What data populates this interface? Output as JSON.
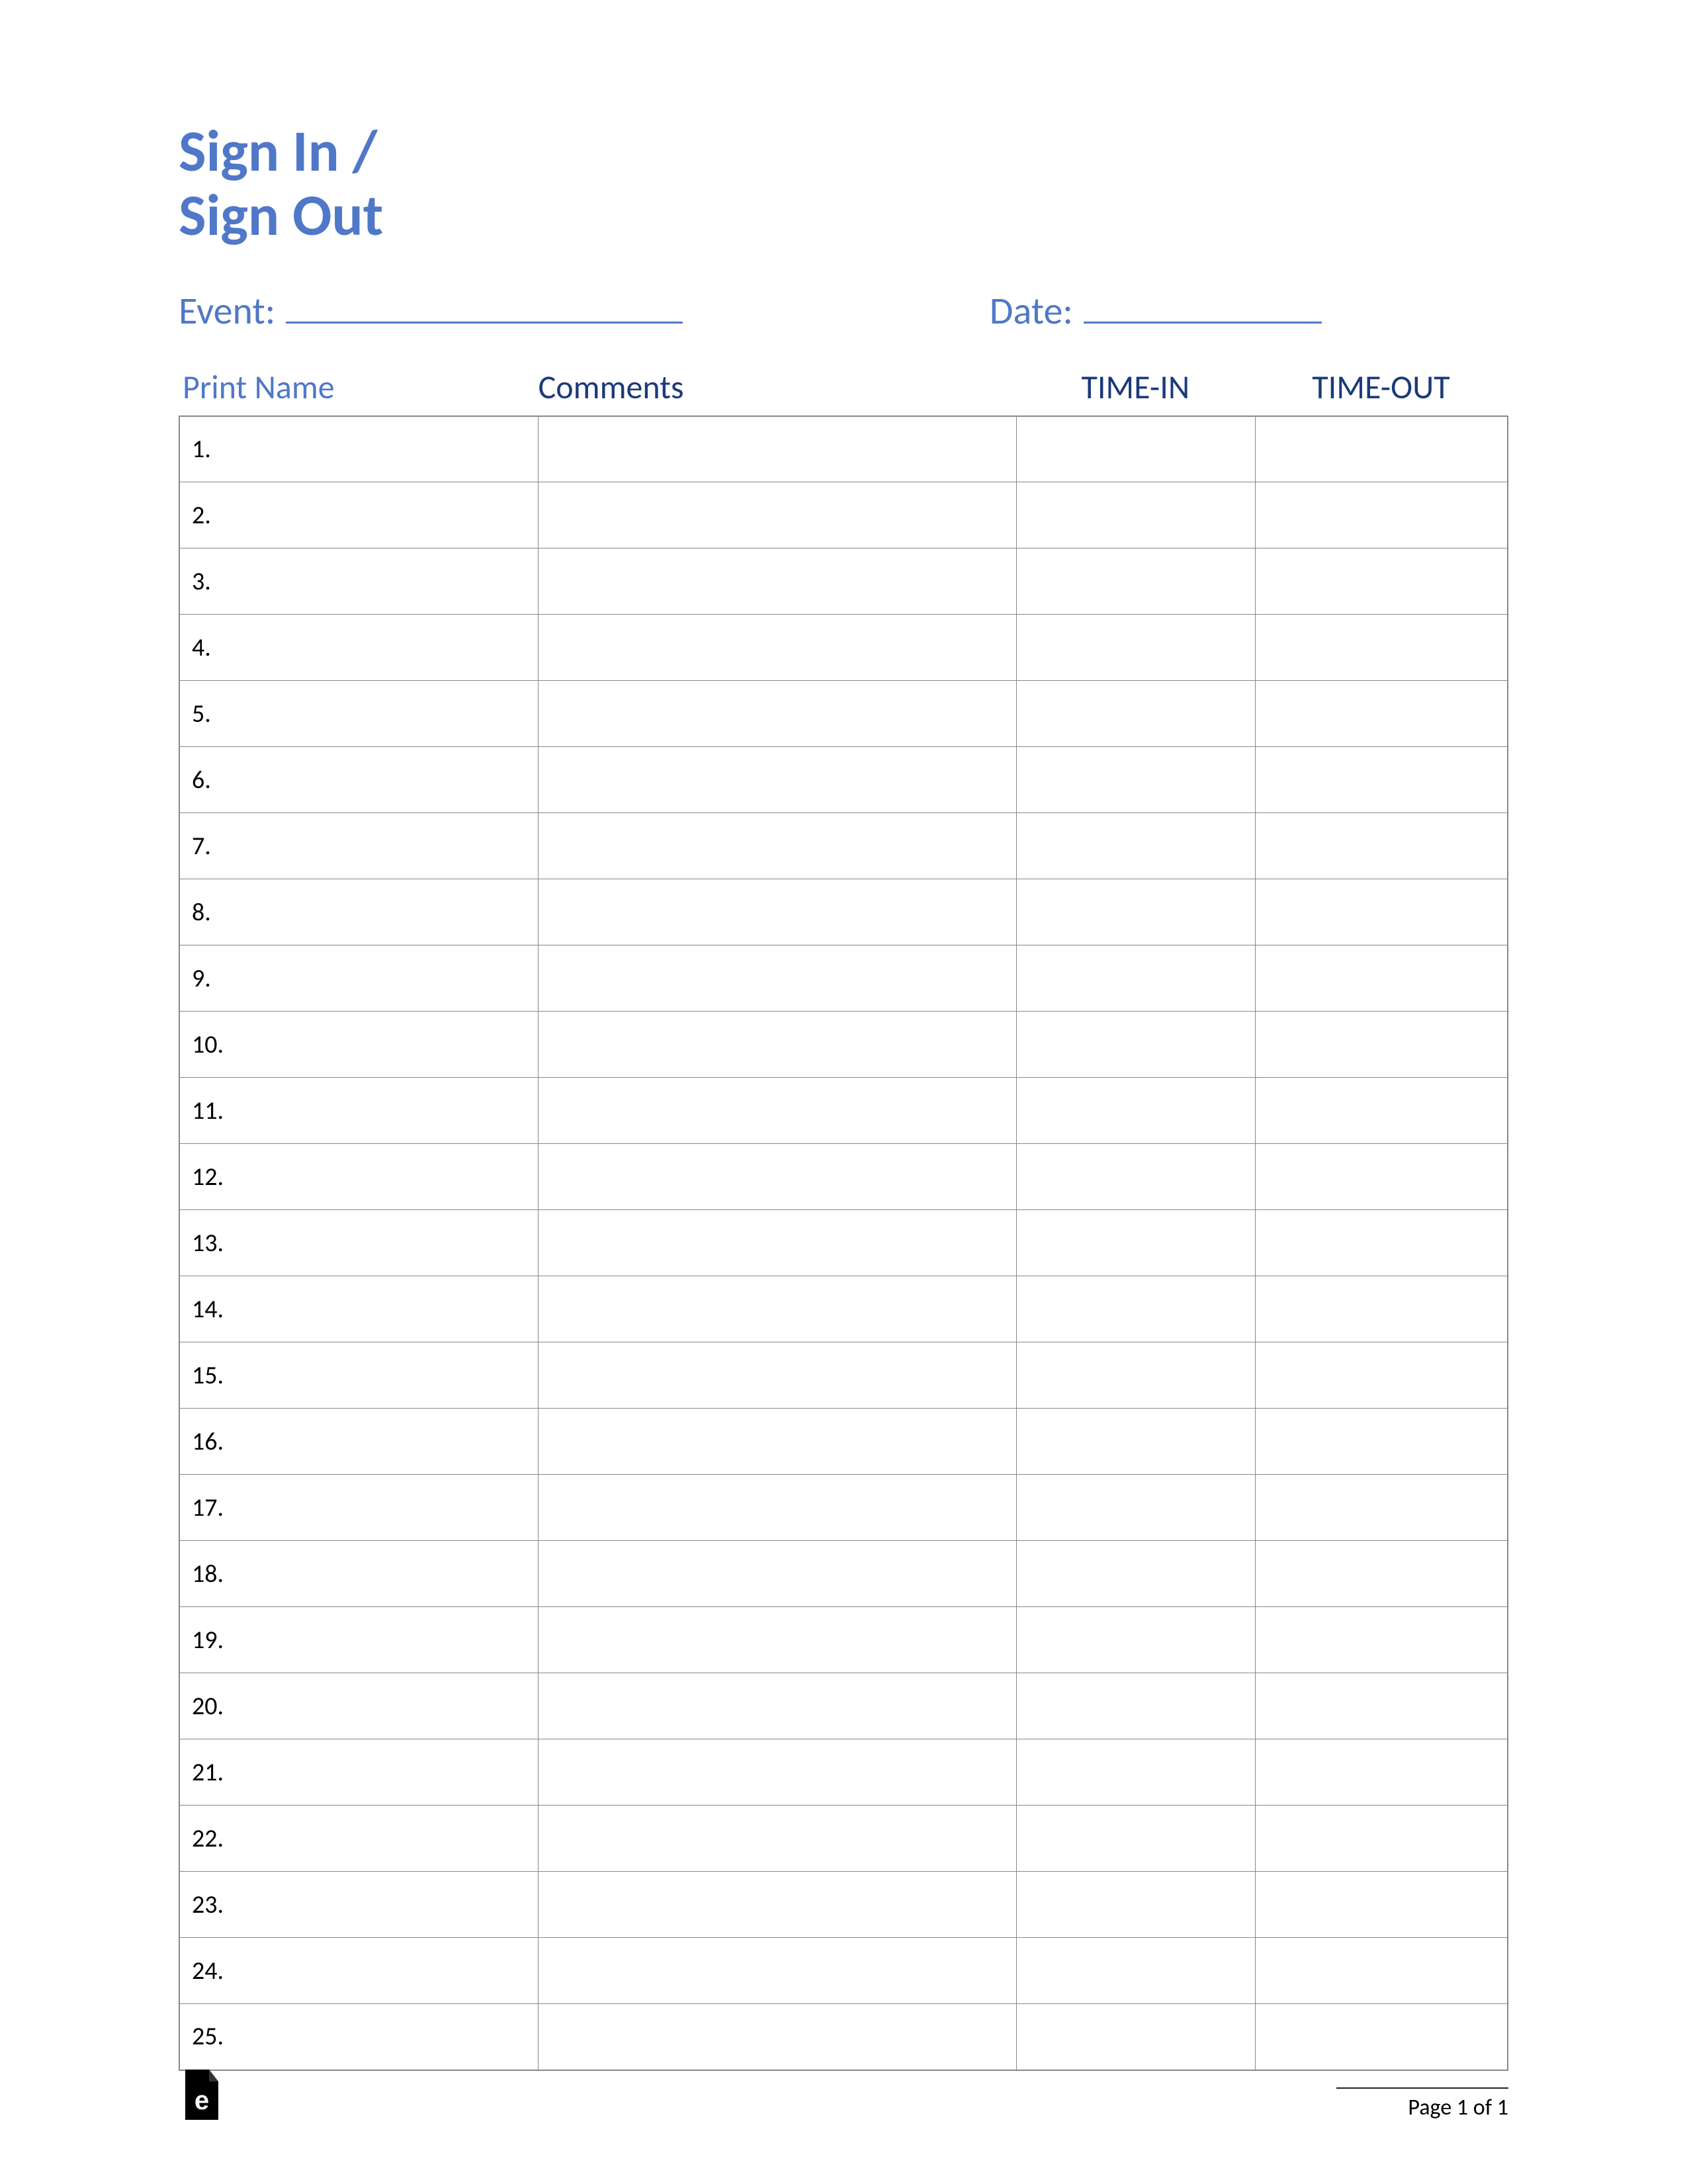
{
  "title": {
    "line1": "Sign In /",
    "line2": "Sign Out"
  },
  "meta": {
    "event_label": "Event:",
    "date_label": "Date:"
  },
  "columns": {
    "print_name": "Print Name",
    "comments": "Comments",
    "time_in": "TIME-IN",
    "time_out": "TIME-OUT"
  },
  "rows": [
    {
      "num": "1."
    },
    {
      "num": "2."
    },
    {
      "num": "3."
    },
    {
      "num": "4."
    },
    {
      "num": "5."
    },
    {
      "num": "6."
    },
    {
      "num": "7."
    },
    {
      "num": "8."
    },
    {
      "num": "9."
    },
    {
      "num": "10."
    },
    {
      "num": "11."
    },
    {
      "num": "12."
    },
    {
      "num": "13."
    },
    {
      "num": "14."
    },
    {
      "num": "15."
    },
    {
      "num": "16."
    },
    {
      "num": "17."
    },
    {
      "num": "18."
    },
    {
      "num": "19."
    },
    {
      "num": "20."
    },
    {
      "num": "21."
    },
    {
      "num": "22."
    },
    {
      "num": "23."
    },
    {
      "num": "24."
    },
    {
      "num": "25."
    }
  ],
  "footer": {
    "page_indicator": "Page 1 of 1"
  }
}
